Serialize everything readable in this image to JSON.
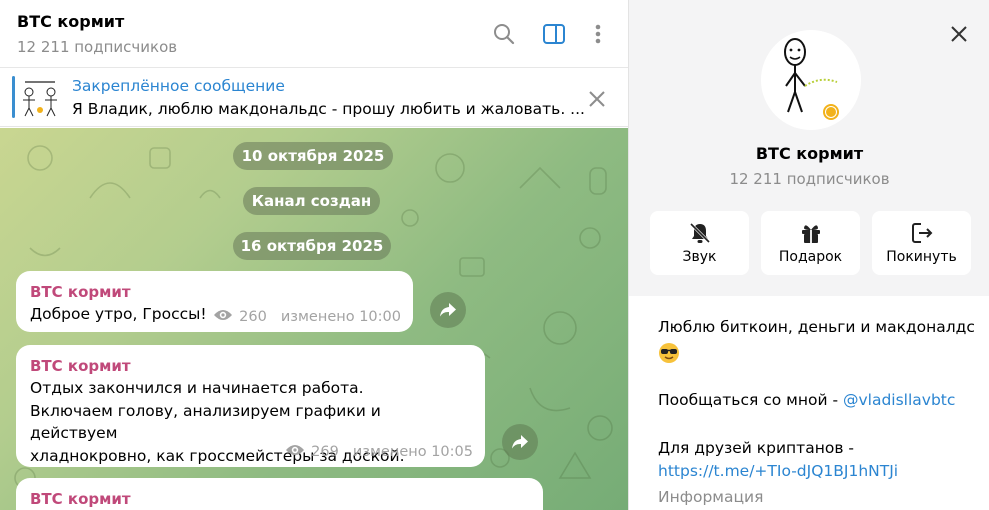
{
  "chat_header": {
    "title": "BTC кормит",
    "subscribers": "12 211 подписчиков"
  },
  "pinned": {
    "title": "Закреплённое сообщение",
    "text": "Я Владик, люблю макдональдс - прошу любить и жаловать. ..."
  },
  "dates": [
    "10 октября 2025",
    "Канал создан",
    "16 октября 2025"
  ],
  "messages": [
    {
      "author": "BTC кормит",
      "text": "Доброе утро, Гроссы!",
      "views": "260",
      "edited": "изменено 10:00"
    },
    {
      "author": "BTC кормит",
      "lines": [
        "Отдых закончился и начинается работа.",
        "Включаем голову, анализируем графики и действуем",
        "хладнокровно, как гроссмейстеры за доской."
      ],
      "views": "269",
      "edited": "изменено 10:05"
    },
    {
      "author": "BTC кормит"
    }
  ],
  "info": {
    "name": "BTC кормит",
    "subscribers": "12 211 подписчиков",
    "actions": {
      "mute": "Звук",
      "gift": "Подарок",
      "leave": "Покинуть"
    },
    "about": {
      "line1": "Люблю биткоин, деньги и макдоналдс",
      "line2_prefix": "Пообщаться со мной - ",
      "line2_link": "@vladisllavbtc",
      "line3": "Для друзей криптанов -",
      "line4_link": "https://t.me/+TIo-dJQ1BJ1hNTJi",
      "line5": "Информация"
    }
  },
  "colors": {
    "accent": "#2b85d1",
    "author": "#c0497a",
    "chat_bg_start": "#c9d691",
    "chat_bg_end": "#76ac76"
  },
  "icons": {
    "search": "search-icon",
    "side_panel": "side-panel-icon",
    "more": "more-vertical-icon",
    "close": "close-icon",
    "forward": "share-arrow-icon",
    "eye": "eye-icon",
    "mute": "bell-off-icon",
    "gift": "gift-icon",
    "leave": "leave-icon"
  }
}
